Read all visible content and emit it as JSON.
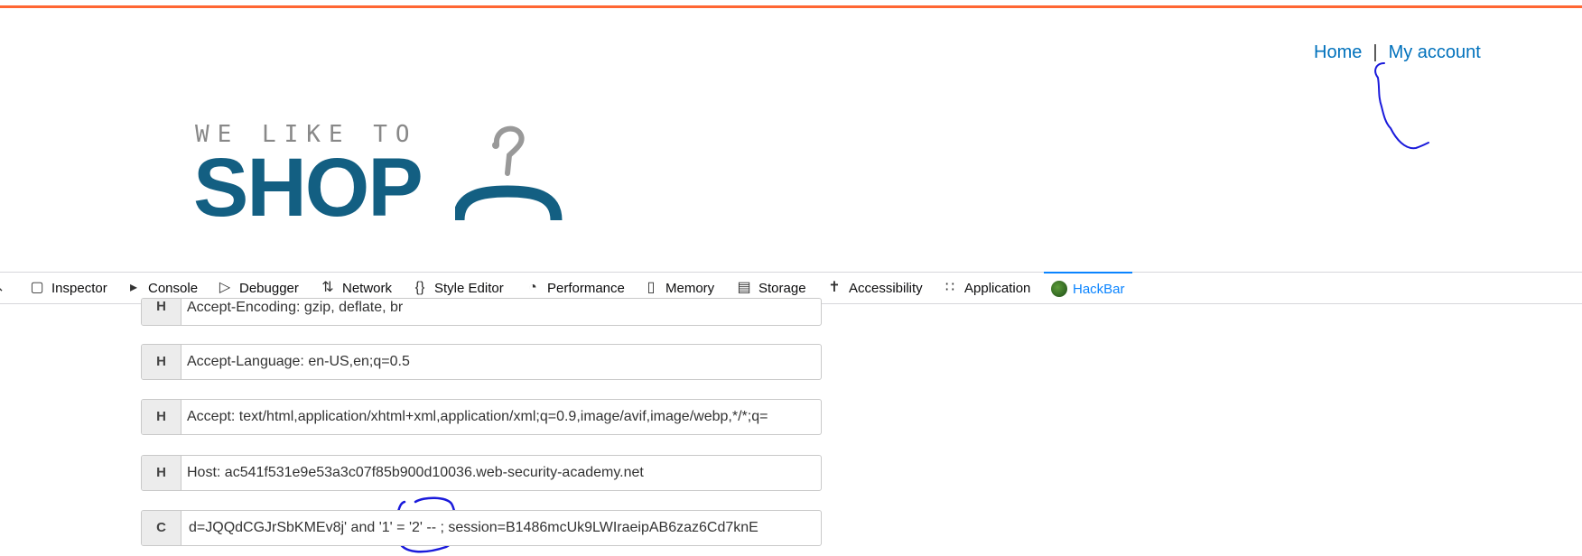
{
  "nav": {
    "home": "Home",
    "separator": "|",
    "my_account": "My account"
  },
  "logo": {
    "tagline": "WE LIKE TO",
    "word": "SHOP"
  },
  "devtools": {
    "tabs": [
      {
        "label": "Inspector",
        "icon": "inspector-icon"
      },
      {
        "label": "Console",
        "icon": "console-icon"
      },
      {
        "label": "Debugger",
        "icon": "debugger-icon"
      },
      {
        "label": "Network",
        "icon": "network-icon"
      },
      {
        "label": "Style Editor",
        "icon": "style-editor-icon"
      },
      {
        "label": "Performance",
        "icon": "performance-icon"
      },
      {
        "label": "Memory",
        "icon": "memory-icon"
      },
      {
        "label": "Storage",
        "icon": "storage-icon"
      },
      {
        "label": "Accessibility",
        "icon": "accessibility-icon"
      },
      {
        "label": "Application",
        "icon": "application-icon"
      },
      {
        "label": "HackBar",
        "icon": "hackbar-icon"
      }
    ],
    "active_tab": "HackBar"
  },
  "headers": [
    {
      "type": "H",
      "value": "Accept-Encoding: gzip, deflate, br"
    },
    {
      "type": "H",
      "value": "Accept-Language: en-US,en;q=0.5"
    },
    {
      "type": "H",
      "value": "Accept: text/html,application/xhtml+xml,application/xml;q=0.9,image/avif,image/webp,*/*;q="
    },
    {
      "type": "H",
      "value": "Host: ac541f531e9e53a3c07f85b900d10036.web-security-academy.net"
    },
    {
      "type": "C",
      "value": "d=JQQdCGJrSbKMEv8j' and '1' = '2' -- ; session=B1486mcUk9LWIraeipAB6zaz6Cd7knE"
    }
  ],
  "colors": {
    "accent": "#ff6633",
    "link": "#0071bc",
    "logo": "#135f82",
    "devtools_active": "#0a84ff",
    "annotation": "#1a1adb"
  }
}
